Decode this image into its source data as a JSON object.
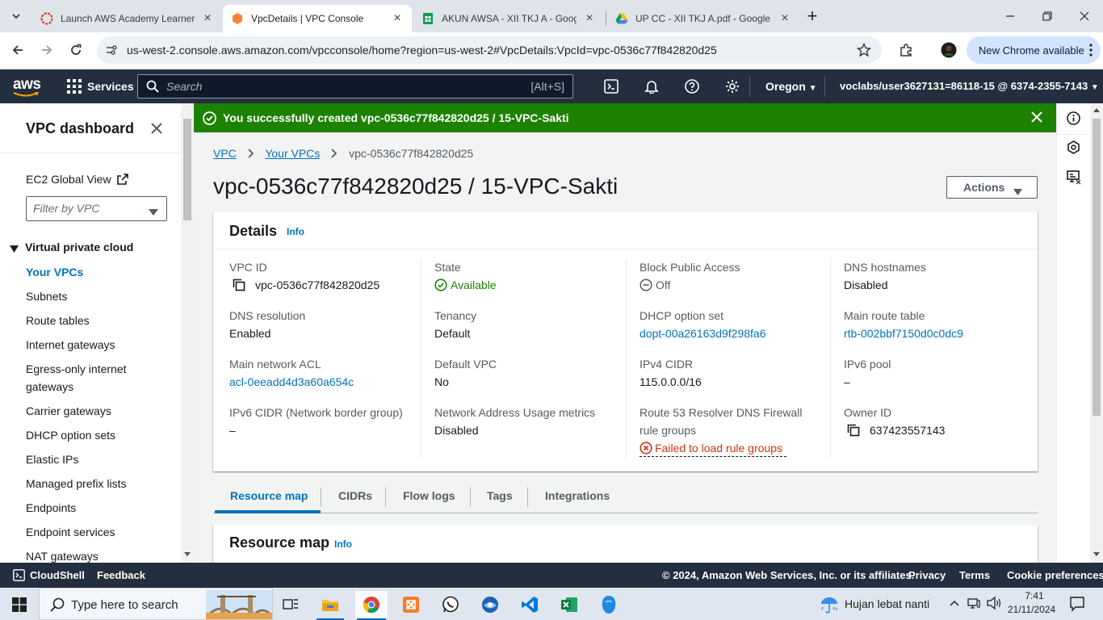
{
  "browser": {
    "tabs": [
      {
        "title": "Launch AWS Academy Learner Lab",
        "active": false
      },
      {
        "title": "VpcDetails | VPC Console",
        "active": true
      },
      {
        "title": "AKUN AWSA - XII TKJ A - Google Sheets",
        "active": false
      },
      {
        "title": "UP CC - XII TKJ A.pdf - Google Drive",
        "active": false
      }
    ],
    "url": "us-west-2.console.aws.amazon.com/vpcconsole/home?region=us-west-2#VpcDetails:VpcId=vpc-0536c77f842820d25",
    "new_chrome": "New Chrome available"
  },
  "aws_header": {
    "logo": "aws",
    "services": "Services",
    "search_placeholder": "Search",
    "search_shortcut": "[Alt+S]",
    "region": "Oregon",
    "account": "voclabs/user3627131=86118-15 @ 6374-2355-7143"
  },
  "sidenav": {
    "title": "VPC dashboard",
    "ec2_global_view": "EC2 Global View",
    "filter_placeholder": "Filter by VPC",
    "section": "Virtual private cloud",
    "items": [
      "Your VPCs",
      "Subnets",
      "Route tables",
      "Internet gateways",
      "Egress-only internet gateways",
      "Carrier gateways",
      "DHCP option sets",
      "Elastic IPs",
      "Managed prefix lists",
      "Endpoints",
      "Endpoint services",
      "NAT gateways"
    ]
  },
  "banner": {
    "message": "You successfully created vpc-0536c77f842820d25 / 15-VPC-Sakti"
  },
  "breadcrumb": [
    "VPC",
    "Your VPCs",
    "vpc-0536c77f842820d25"
  ],
  "page_title": "vpc-0536c77f842820d25 / 15-VPC-Sakti",
  "actions_label": "Actions",
  "details": {
    "heading": "Details",
    "info": "Info",
    "fields": {
      "vpc_id": {
        "label": "VPC ID",
        "value": "vpc-0536c77f842820d25"
      },
      "state": {
        "label": "State",
        "value": "Available"
      },
      "block_public_access": {
        "label": "Block Public Access",
        "value": "Off"
      },
      "dns_hostnames": {
        "label": "DNS hostnames",
        "value": "Disabled"
      },
      "dns_resolution": {
        "label": "DNS resolution",
        "value": "Enabled"
      },
      "tenancy": {
        "label": "Tenancy",
        "value": "Default"
      },
      "dhcp_option_set": {
        "label": "DHCP option set",
        "value": "dopt-00a26163d9f298fa6"
      },
      "main_route_table": {
        "label": "Main route table",
        "value": "rtb-002bbf7150d0c0dc9"
      },
      "main_network_acl": {
        "label": "Main network ACL",
        "value": "acl-0eeadd4d3a60a654c"
      },
      "default_vpc": {
        "label": "Default VPC",
        "value": "No"
      },
      "ipv4_cidr": {
        "label": "IPv4 CIDR",
        "value": "115.0.0.0/16"
      },
      "ipv6_pool": {
        "label": "IPv6 pool",
        "value": "–"
      },
      "ipv6_cidr": {
        "label": "IPv6 CIDR (Network border group)",
        "value": "–"
      },
      "nau_metrics": {
        "label": "Network Address Usage metrics",
        "value": "Disabled"
      },
      "route53": {
        "label_line1": "Route 53 Resolver DNS Firewall",
        "label_line2": "rule groups",
        "value": "Failed to load rule groups"
      },
      "owner_id": {
        "label": "Owner ID",
        "value": "637423557143"
      }
    }
  },
  "tabs": [
    "Resource map",
    "CIDRs",
    "Flow logs",
    "Tags",
    "Integrations"
  ],
  "resource_map": {
    "heading": "Resource map",
    "info": "Info"
  },
  "footer": {
    "cloudshell": "CloudShell",
    "feedback": "Feedback",
    "copyright": "© 2024, Amazon Web Services, Inc. or its affiliates.",
    "privacy": "Privacy",
    "terms": "Terms",
    "cookies": "Cookie preferences"
  },
  "taskbar": {
    "search_placeholder": "Type here to search",
    "weather": "Hujan lebat nanti",
    "time": "7:41",
    "date": "21/11/2024"
  },
  "colors": {
    "aws_nav": "#232f3e",
    "success_green": "#1d8102",
    "link_blue": "#0073bb",
    "error_red": "#d13212",
    "aws_orange": "#ff9900"
  }
}
